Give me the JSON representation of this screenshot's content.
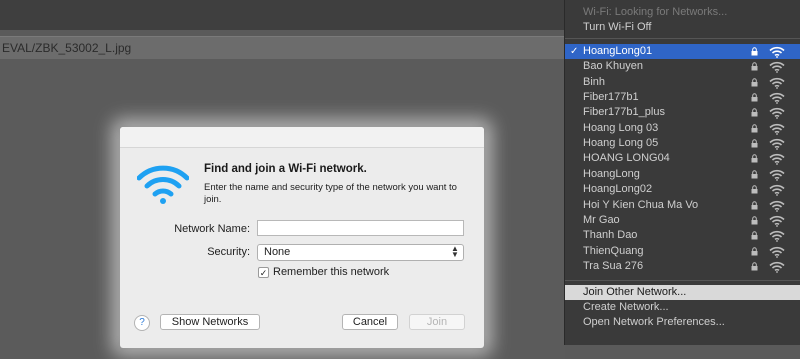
{
  "window": {
    "path": "EVAL/ZBK_53002_L.jpg"
  },
  "dialog": {
    "title": "Find and join a Wi-Fi network.",
    "description": "Enter the name and security type of the network you want to join.",
    "network_name_label": "Network Name:",
    "network_name_value": "",
    "security_label": "Security:",
    "security_value": "None",
    "remember_label": "Remember this network",
    "remember_checked": true,
    "help_label": "?",
    "show_networks_label": "Show Networks",
    "cancel_label": "Cancel",
    "join_label": "Join"
  },
  "wifi_menu": {
    "status": "Wi-Fi: Looking for Networks...",
    "turn_off": "Turn Wi-Fi Off",
    "networks": [
      {
        "name": "HoangLong01",
        "selected": true
      },
      {
        "name": "Bao Khuyen"
      },
      {
        "name": "Binh"
      },
      {
        "name": "Fiber177b1"
      },
      {
        "name": "Fiber177b1_plus"
      },
      {
        "name": "Hoang Long 03"
      },
      {
        "name": "Hoang Long 05"
      },
      {
        "name": "HOANG LONG04"
      },
      {
        "name": "HoangLong"
      },
      {
        "name": "HoangLong02"
      },
      {
        "name": "Hoi Y Kien Chua Ma Vo"
      },
      {
        "name": "Mr Gao"
      },
      {
        "name": "Thanh Dao"
      },
      {
        "name": "ThienQuang"
      },
      {
        "name": "Tra Sua 276"
      }
    ],
    "join_other": "Join Other Network...",
    "create": "Create Network...",
    "preferences": "Open Network Preferences...",
    "check_glyph": "✓"
  },
  "colors": {
    "accent": "#2f65c7",
    "wifi_blue": "#1ea1f2"
  }
}
